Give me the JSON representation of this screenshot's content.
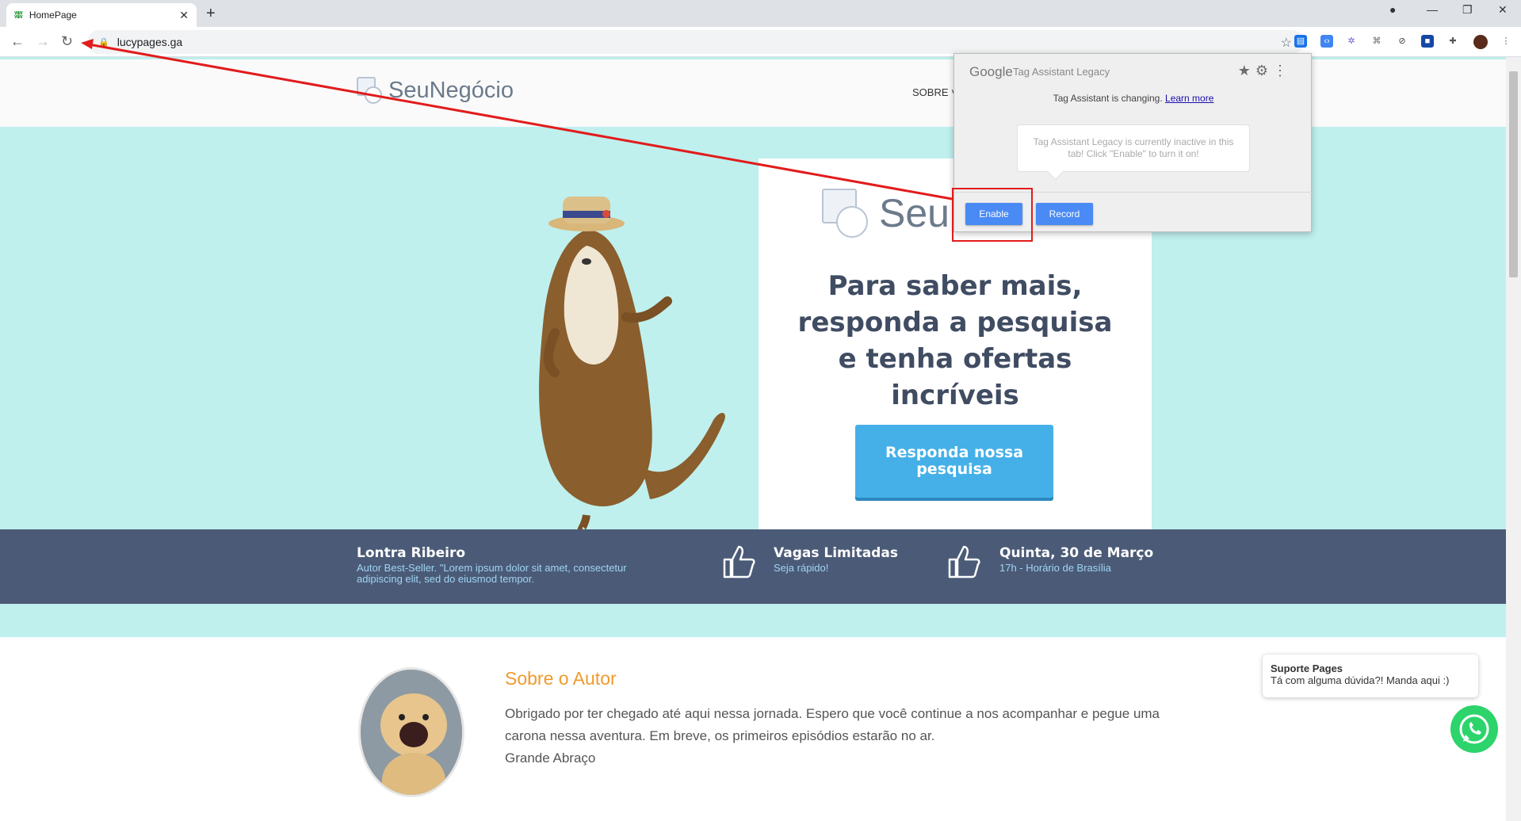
{
  "browser": {
    "tab_title": "HomePage",
    "url": "lucypages.ga",
    "new_tab": "+",
    "tab_close": "✕"
  },
  "site": {
    "logo_text": "SeuNegócio",
    "nav_sobre": "SOBRE ˅"
  },
  "hero": {
    "card_logo_text": "Seu",
    "title": "Para saber mais, responda a pesquisa e tenha ofertas incríveis",
    "cta": "Responda nossa pesquisa"
  },
  "band": {
    "items": [
      {
        "title": "Lontra Ribeiro",
        "subtitle": "Autor Best-Seller. \"Lorem ipsum dolor sit amet, consectetur adipiscing elit, sed do eiusmod tempor."
      },
      {
        "title": "Vagas Limitadas",
        "subtitle": "Seja rápido!"
      },
      {
        "title": "Quinta, 30 de Março",
        "subtitle": "17h - Horário de Brasília"
      }
    ]
  },
  "about": {
    "title": "Sobre o Autor",
    "line1": "Obrigado por ter chegado até aqui nessa jornada. Espero que você continue a nos acompanhar e pegue uma carona nessa aventura. Em breve, os primeiros episódios estarão no ar.",
    "line2": "Grande Abraço"
  },
  "support": {
    "title": "Suporte Pages",
    "message": "Tá com alguma dúvida?! Manda aqui :)"
  },
  "tag_assistant": {
    "brand": "Google",
    "title": "Tag Assistant Legacy",
    "changing": "Tag Assistant is changing.",
    "learn_more": "Learn more",
    "bubble": "Tag Assistant Legacy is currently inactive in this tab! Click \"Enable\" to turn it on!",
    "enable": "Enable",
    "record": "Record"
  },
  "colors": {
    "hero_bg": "#bff0ee",
    "band_bg": "#4b5b77",
    "cta_bg": "#45b0e8",
    "accent_orange": "#f09a2c",
    "annotation_red": "#e21b1b"
  }
}
